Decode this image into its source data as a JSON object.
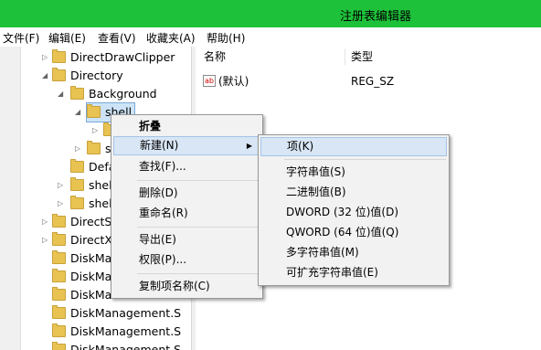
{
  "window": {
    "title": "注册表编辑器",
    "titlebar_color": "#1ec23a"
  },
  "menubar": [
    {
      "label": "文件(F)"
    },
    {
      "label": "编辑(E)"
    },
    {
      "label": "查看(V)"
    },
    {
      "label": "收藏夹(A)"
    },
    {
      "label": "帮助(H)"
    }
  ],
  "tree": [
    {
      "label": "DirectDrawClipper",
      "expander": "▷"
    },
    {
      "label": "Directory",
      "expander": "◢"
    },
    {
      "label": "Background",
      "expander": "◢"
    },
    {
      "label": "shell",
      "expander": "◢"
    },
    {
      "label": "",
      "expander": "▷"
    },
    {
      "label": "s",
      "expander": "▷"
    },
    {
      "label": "Defa",
      "expander": ""
    },
    {
      "label": "shel",
      "expander": "▷"
    },
    {
      "label": "shel",
      "expander": "▷"
    },
    {
      "label": "DirectS",
      "expander": "▷"
    },
    {
      "label": "DirectX",
      "expander": "▷"
    },
    {
      "label": "DiskMa",
      "expander": ""
    },
    {
      "label": "DiskMa",
      "expander": ""
    },
    {
      "label": "DiskMa",
      "expander": ""
    },
    {
      "label": "DiskManagement.S",
      "expander": ""
    },
    {
      "label": "DiskManagement.S",
      "expander": ""
    },
    {
      "label": "DiskManagement.S",
      "expander": ""
    }
  ],
  "values_header": {
    "name": "名称",
    "type": "类型"
  },
  "values": [
    {
      "icon": "ab",
      "name": "(默认)",
      "type": "REG_SZ"
    }
  ],
  "context_menu": [
    {
      "label": "折叠",
      "bold": true
    },
    {
      "label": "新建(N)",
      "submenu": true,
      "arrow": "▶"
    },
    {
      "label": "查找(F)..."
    },
    {
      "label": "删除(D)"
    },
    {
      "label": "重命名(R)"
    },
    {
      "label": "导出(E)"
    },
    {
      "label": "权限(P)..."
    },
    {
      "label": "复制项名称(C)"
    }
  ],
  "submenu": [
    {
      "label": "项(K)"
    },
    {
      "label": "字符串值(S)"
    },
    {
      "label": "二进制值(B)"
    },
    {
      "label": "DWORD (32 位)值(D)"
    },
    {
      "label": "QWORD (64 位)值(Q)"
    },
    {
      "label": "多字符串值(M)"
    },
    {
      "label": "可扩充字符串值(E)"
    }
  ]
}
